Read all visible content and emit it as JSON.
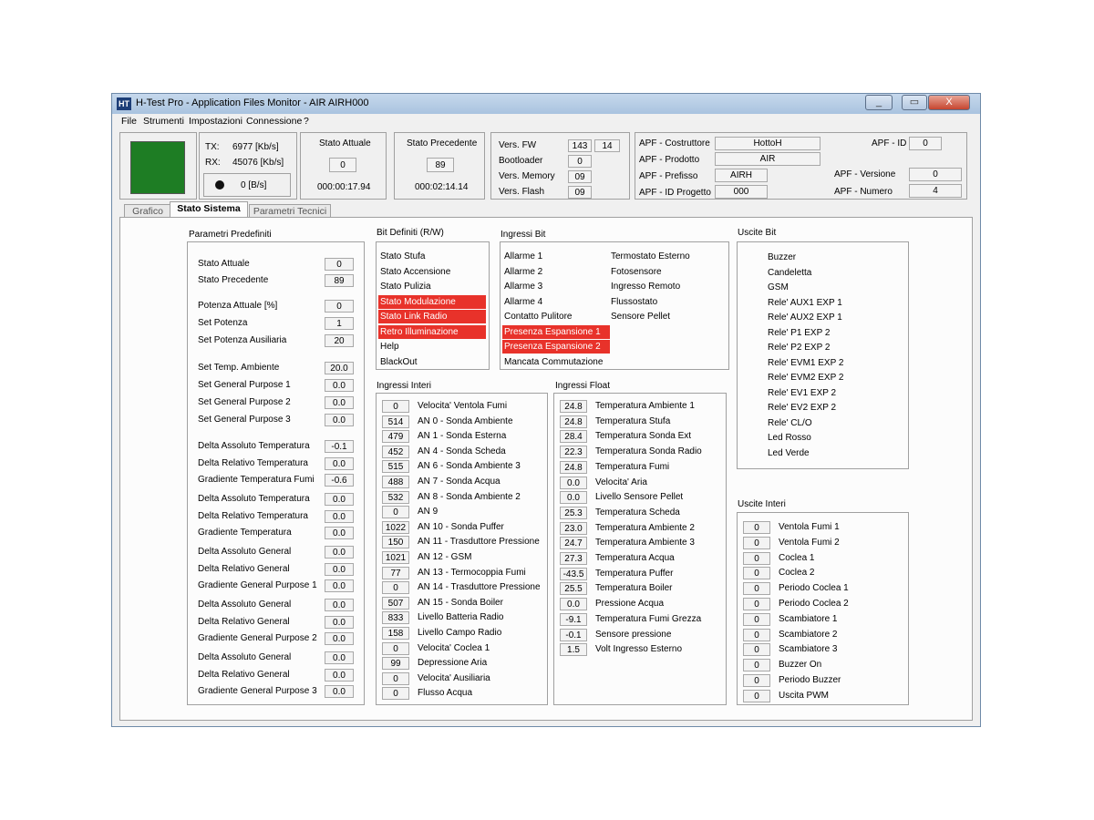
{
  "window": {
    "title": "H-Test Pro - Application Files Monitor - AIR AIRH000",
    "icon": "HT"
  },
  "window_buttons": {
    "minimize": "▭",
    "restore": "▭",
    "close": "X"
  },
  "menu": [
    "File",
    "Strumenti",
    "Impostazioni",
    "Connessione",
    "?"
  ],
  "status": {
    "indicator_color": "#1e7d24",
    "tx_label": "TX:",
    "tx_value": "6977 [Kb/s]",
    "rx_label": "RX:",
    "rx_value": "45076 [Kb/s]",
    "rate_value": "0 [B/s]"
  },
  "stato_attuale": {
    "label": "Stato Attuale",
    "value": "0",
    "time": "000:00:17.94"
  },
  "stato_precedente": {
    "label": "Stato Precedente",
    "value": "89",
    "time": "000:02:14.14"
  },
  "versions": {
    "fw_label": "Vers. FW",
    "fw_a": "143",
    "fw_b": "14",
    "boot_label": "Bootloader",
    "boot": "0",
    "mem_label": "Vers. Memory",
    "mem": "09",
    "flash_label": "Vers. Flash",
    "flash": "09"
  },
  "apf": {
    "costruttore_label": "APF - Costruttore",
    "costruttore": "HottoH",
    "prodotto_label": "APF - Prodotto",
    "prodotto": "AIR",
    "prefisso_label": "APF - Prefisso",
    "prefisso": "AIRH",
    "idprog_label": "APF - ID Progetto",
    "idprog": "000",
    "id_label": "APF - ID",
    "id": "0",
    "versione_label": "APF - Versione",
    "versione": "0",
    "numero_label": "APF - Numero",
    "numero": "4"
  },
  "tabs": [
    {
      "label": "Grafico",
      "active": false
    },
    {
      "label": "Stato Sistema",
      "active": true
    },
    {
      "label": "Parametri Tecnici",
      "active": false
    }
  ],
  "parametri": {
    "title": "Parametri Predefiniti",
    "items": [
      {
        "label": "Stato Attuale",
        "value": "0"
      },
      {
        "label": "Stato Precedente",
        "value": "89"
      },
      {
        "label": "Potenza Attuale [%]",
        "value": "0"
      },
      {
        "label": "Set Potenza",
        "value": "1"
      },
      {
        "label": "Set Potenza Ausiliaria",
        "value": "20"
      },
      {
        "label": "Set Temp. Ambiente",
        "value": "20.0"
      },
      {
        "label": "Set General Purpose 1",
        "value": "0.0"
      },
      {
        "label": "Set General Purpose 2",
        "value": "0.0"
      },
      {
        "label": "Set General Purpose 3",
        "value": "0.0"
      },
      {
        "label": "Delta Assoluto Temperatura",
        "value": "-0.1"
      },
      {
        "label": "Delta Relativo Temperatura",
        "value": "0.0"
      },
      {
        "label": "Gradiente Temperatura Fumi",
        "value": "-0.6"
      },
      {
        "label": "Delta Assoluto Temperatura",
        "value": "0.0"
      },
      {
        "label": "Delta Relativo Temperatura",
        "value": "0.0"
      },
      {
        "label": "Gradiente Temperatura",
        "value": "0.0"
      },
      {
        "label": "Delta Assoluto General",
        "value": "0.0"
      },
      {
        "label": "Delta Relativo General",
        "value": "0.0"
      },
      {
        "label": "Gradiente General Purpose 1",
        "value": "0.0"
      },
      {
        "label": "Delta Assoluto General",
        "value": "0.0"
      },
      {
        "label": "Delta Relativo General",
        "value": "0.0"
      },
      {
        "label": "Gradiente General Purpose 2",
        "value": "0.0"
      },
      {
        "label": "Delta Assoluto General",
        "value": "0.0"
      },
      {
        "label": "Delta Relativo General",
        "value": "0.0"
      },
      {
        "label": "Gradiente General Purpose 3",
        "value": "0.0"
      }
    ]
  },
  "bit_definiti": {
    "title": "Bit Definiti (R/W)",
    "items": [
      {
        "label": "Stato Stufa",
        "active": false
      },
      {
        "label": "Stato Accensione",
        "active": false
      },
      {
        "label": "Stato Pulizia",
        "active": false
      },
      {
        "label": "Stato Modulazione",
        "active": true
      },
      {
        "label": "Stato Link Radio",
        "active": true
      },
      {
        "label": "Retro Illuminazione",
        "active": true
      },
      {
        "label": "Help",
        "active": false
      },
      {
        "label": "BlackOut",
        "active": false
      }
    ]
  },
  "ingressi_bit": {
    "title": "Ingressi Bit",
    "col1": [
      {
        "label": "Allarme 1",
        "active": false
      },
      {
        "label": "Allarme 2",
        "active": false
      },
      {
        "label": "Allarme 3",
        "active": false
      },
      {
        "label": "Allarme 4",
        "active": false
      },
      {
        "label": "Contatto Pulitore",
        "active": false
      },
      {
        "label": "Presenza Espansione 1",
        "active": true
      },
      {
        "label": "Presenza Espansione 2",
        "active": true
      },
      {
        "label": "Mancata Commutazione",
        "active": false
      }
    ],
    "col2": [
      "Termostato Esterno",
      "Fotosensore",
      "Ingresso Remoto",
      "Flussostato",
      "Sensore Pellet"
    ]
  },
  "uscite_bit": {
    "title": "Uscite Bit",
    "items": [
      "Buzzer",
      "Candeletta",
      "GSM",
      "Rele' AUX1 EXP 1",
      "Rele' AUX2 EXP 1",
      "Rele' P1 EXP 2",
      "Rele' P2 EXP 2",
      "Rele' EVM1 EXP 2",
      "Rele' EVM2 EXP 2",
      "Rele' EV1 EXP 2",
      "Rele' EV2 EXP 2",
      "Rele' CL/O",
      "Led Rosso",
      "Led Verde"
    ]
  },
  "ingressi_interi": {
    "title": "Ingressi Interi",
    "items": [
      {
        "value": "0",
        "label": "Velocita' Ventola Fumi"
      },
      {
        "value": "514",
        "label": "AN 0 - Sonda Ambiente"
      },
      {
        "value": "479",
        "label": "AN 1 - Sonda Esterna"
      },
      {
        "value": "452",
        "label": "AN 4 - Sonda Scheda"
      },
      {
        "value": "515",
        "label": "AN 6 - Sonda Ambiente 3"
      },
      {
        "value": "488",
        "label": "AN 7 - Sonda Acqua"
      },
      {
        "value": "532",
        "label": "AN 8 - Sonda Ambiente 2"
      },
      {
        "value": "0",
        "label": "AN 9"
      },
      {
        "value": "1022",
        "label": "AN 10 - Sonda Puffer"
      },
      {
        "value": "150",
        "label": "AN 11 - Trasduttore Pressione"
      },
      {
        "value": "1021",
        "label": "AN 12 - GSM"
      },
      {
        "value": "77",
        "label": "AN 13 - Termocoppia Fumi"
      },
      {
        "value": "0",
        "label": "AN 14 - Trasduttore Pressione"
      },
      {
        "value": "507",
        "label": "AN 15 - Sonda Boiler"
      },
      {
        "value": "833",
        "label": "Livello Batteria Radio"
      },
      {
        "value": "158",
        "label": "Livello Campo Radio"
      },
      {
        "value": "0",
        "label": "Velocita' Coclea 1"
      },
      {
        "value": "99",
        "label": "Depressione Aria"
      },
      {
        "value": "0",
        "label": "Velocita' Ausiliaria"
      },
      {
        "value": "0",
        "label": "Flusso Acqua"
      }
    ]
  },
  "ingressi_float": {
    "title": "Ingressi Float",
    "items": [
      {
        "value": "24.8",
        "label": "Temperatura Ambiente 1"
      },
      {
        "value": "24.8",
        "label": "Temperatura Stufa"
      },
      {
        "value": "28.4",
        "label": "Temperatura Sonda Ext"
      },
      {
        "value": "22.3",
        "label": "Temperatura Sonda Radio"
      },
      {
        "value": "24.8",
        "label": "Temperatura Fumi"
      },
      {
        "value": "0.0",
        "label": "Velocita' Aria"
      },
      {
        "value": "0.0",
        "label": "Livello Sensore Pellet"
      },
      {
        "value": "25.3",
        "label": "Temperatura Scheda"
      },
      {
        "value": "23.0",
        "label": "Temperatura Ambiente 2"
      },
      {
        "value": "24.7",
        "label": "Temperatura Ambiente 3"
      },
      {
        "value": "27.3",
        "label": "Temperatura Acqua"
      },
      {
        "value": "-43.5",
        "label": "Temperatura Puffer"
      },
      {
        "value": "25.5",
        "label": "Temperatura Boiler"
      },
      {
        "value": "0.0",
        "label": "Pressione Acqua"
      },
      {
        "value": "-9.1",
        "label": "Temperatura Fumi Grezza"
      },
      {
        "value": "-0.1",
        "label": "Sensore pressione"
      },
      {
        "value": "1.5",
        "label": "Volt Ingresso Esterno"
      }
    ]
  },
  "uscite_interi": {
    "title": "Uscite Interi",
    "items": [
      {
        "value": "0",
        "label": "Ventola Fumi 1"
      },
      {
        "value": "0",
        "label": "Ventola Fumi 2"
      },
      {
        "value": "0",
        "label": "Coclea 1"
      },
      {
        "value": "0",
        "label": "Coclea 2"
      },
      {
        "value": "0",
        "label": "Periodo Coclea 1"
      },
      {
        "value": "0",
        "label": "Periodo Coclea 2"
      },
      {
        "value": "0",
        "label": "Scambiatore 1"
      },
      {
        "value": "0",
        "label": "Scambiatore 2"
      },
      {
        "value": "0",
        "label": "Scambiatore 3"
      },
      {
        "value": "0",
        "label": "Buzzer On"
      },
      {
        "value": "0",
        "label": "Periodo Buzzer"
      },
      {
        "value": "0",
        "label": "Uscita PWM"
      }
    ]
  }
}
